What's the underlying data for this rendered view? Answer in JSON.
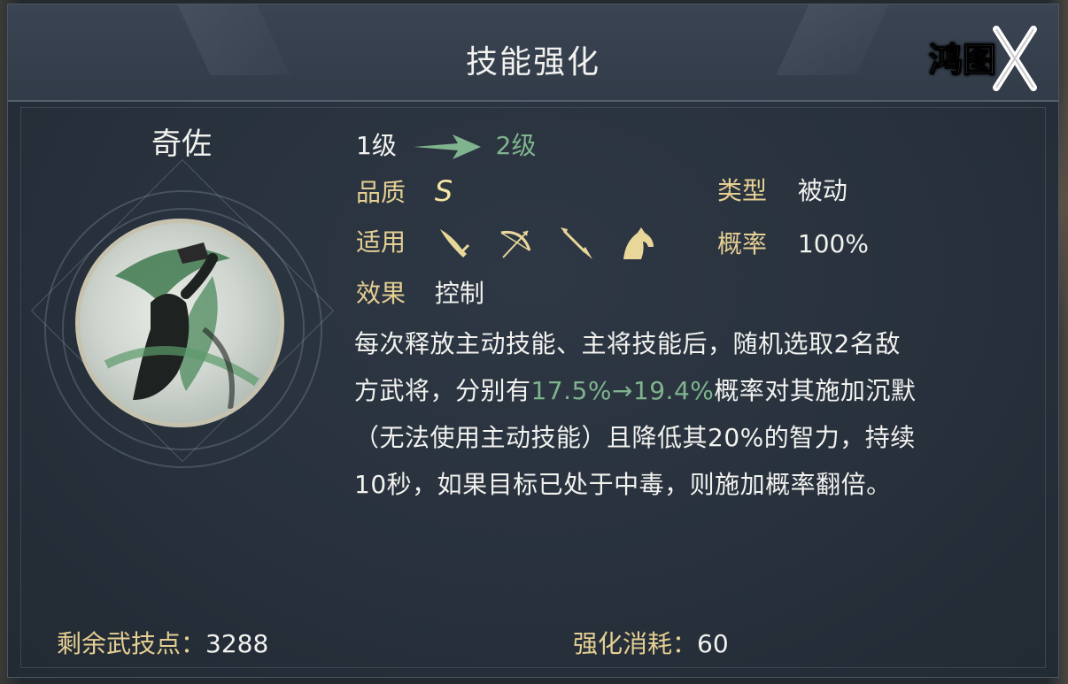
{
  "dialog": {
    "title": "技能强化",
    "logo_text": "鸿图X"
  },
  "hero": {
    "name": "奇佐"
  },
  "skill": {
    "level_from": "1级",
    "level_to": "2级",
    "quality_label": "品质",
    "quality_value": "S",
    "type_label": "类型",
    "type_value": "被动",
    "applicable_label": "适用",
    "applicable_icons": [
      "sword-icon",
      "bow-icon",
      "spear-icon",
      "horse-icon"
    ],
    "probability_label": "概率",
    "probability_value": "100%",
    "effect_label": "效果",
    "effect_value": "控制",
    "description": {
      "line1": "每次释放主动技能、主将技能后，随机选取2名敌",
      "line2_prefix": "方武将，分别有",
      "line2_highlight": "17.5%→19.4%",
      "line2_suffix": "概率对其施加沉默",
      "line3": "（无法使用主动技能）且降低其20%的智力，持续",
      "line4": "10秒，如果目标已处于中毒，则施加概率翻倍。"
    }
  },
  "footer": {
    "remaining_label": "剩余武技点：",
    "remaining_value": "3288",
    "cost_label": "强化消耗：",
    "cost_value": "60"
  },
  "colors": {
    "label": "#e5cf93",
    "highlight_green": "#7fb48e",
    "quality": "#f6e6a4",
    "text": "#f2f2ef",
    "panel_bg": "#27303b"
  }
}
